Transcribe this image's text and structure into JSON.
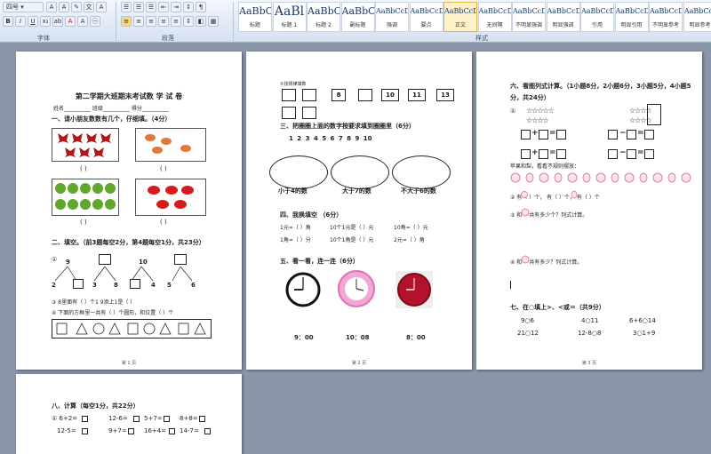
{
  "ribbon": {
    "font_size_value": "四号",
    "font_label": "字体",
    "paragraph_label": "段落",
    "styles_label": "样式",
    "styles": [
      {
        "sample": "AaBbC",
        "name": "标题",
        "size": 11
      },
      {
        "sample": "AaBl",
        "name": "标题 1",
        "size": 14
      },
      {
        "sample": "AaBbC",
        "name": "标题 2",
        "size": 11
      },
      {
        "sample": "AaBbC",
        "name": "副标题",
        "size": 11
      },
      {
        "sample": "AaBbCcDd",
        "name": "强调",
        "size": 8
      },
      {
        "sample": "AaBbCcD",
        "name": "要点",
        "size": 8
      },
      {
        "sample": "AaBbCcDd",
        "name": "正文",
        "size": 8
      },
      {
        "sample": "AaBbCcDd",
        "name": "无间隔",
        "size": 8
      },
      {
        "sample": "AaBbCcDd",
        "name": "不明显强调",
        "size": 8
      },
      {
        "sample": "AaBbCcDd",
        "name": "明显强调",
        "size": 8
      },
      {
        "sample": "AaBbCcDd",
        "name": "引用",
        "size": 8
      },
      {
        "sample": "AaBbCcDd",
        "name": "明显引用",
        "size": 8
      },
      {
        "sample": "AaBbCcDd",
        "name": "不明显参考",
        "size": 8
      },
      {
        "sample": "AaBbCcI",
        "name": "明显参考",
        "size": 8
      }
    ]
  },
  "page1": {
    "title": "第二学期大班期末考试数 学 试 卷",
    "info": "姓名__________   班级__________   得分__________",
    "s1": "一、请小朋友数数有几个，仔细填。（4分）",
    "s2": "二、填空。（前3题每空2分，第4题每空1分，共23分）",
    "tree_top": [
      "9",
      "10"
    ],
    "tree_bottom": [
      "2",
      "3",
      "8",
      "4",
      "5",
      "6"
    ],
    "q3": "③ 8里面有（    ）个1        9添上1是（    ）",
    "q4": "④ 下面的方框里一共有（    ）个圆形，和位置（    ）个",
    "footer": "第 1 页"
  },
  "page2": {
    "seq_label": "②找规律填数",
    "seq": [
      "8",
      "10",
      "11",
      "13"
    ],
    "s3": "三、把圈圈上面的数字按要求填到圈圈里（6分）",
    "digits": "1  2  3   4   5   6   7   8   9   10",
    "ovals": [
      "小于4的数",
      "大于7的数",
      "不大于6的数"
    ],
    "s4": "四、我换填空 （6分）",
    "conv": [
      [
        "1元=（   ）角",
        "10个1元是（   ）元",
        "10角=（   ）元"
      ],
      [
        "1角=（   ）分",
        "10个1角是（   ）元",
        "2元=（   ）角"
      ]
    ],
    "s5": "五、看一看，连一连（6分）",
    "times": [
      "9：00",
      "10：08",
      "8：00"
    ],
    "footer": "第 2 页"
  },
  "page3": {
    "s6": "六、看图列式计算。（1小题8分，2小题6分，3小题5分，4小题5分，共24分）",
    "q1": "①",
    "q2label": "苹果和梨，看看不规则摆放：",
    "q2": "②   有（   ）个，   有（   ）个，   有（   ）个",
    "q3": "③     和     一共有多少个？列式计算。",
    "q4": "④     和     一共有多少？列式计算。",
    "s7": "七、在○填上>、<或＝（共9分）",
    "cmp": [
      [
        "9○6",
        "4○11",
        "6+6○14"
      ],
      [
        "21○12",
        "12-8○8",
        "3○1+9"
      ]
    ],
    "footer": "第 3 页"
  },
  "page4": {
    "s8": "八、计算（每空1分，共22分）",
    "calc": [
      [
        "① 6+2=",
        "12-6=",
        "5+7=",
        "8+8="
      ],
      [
        "12-5=",
        "9+7=",
        "16+4=",
        "14-7="
      ]
    ]
  }
}
